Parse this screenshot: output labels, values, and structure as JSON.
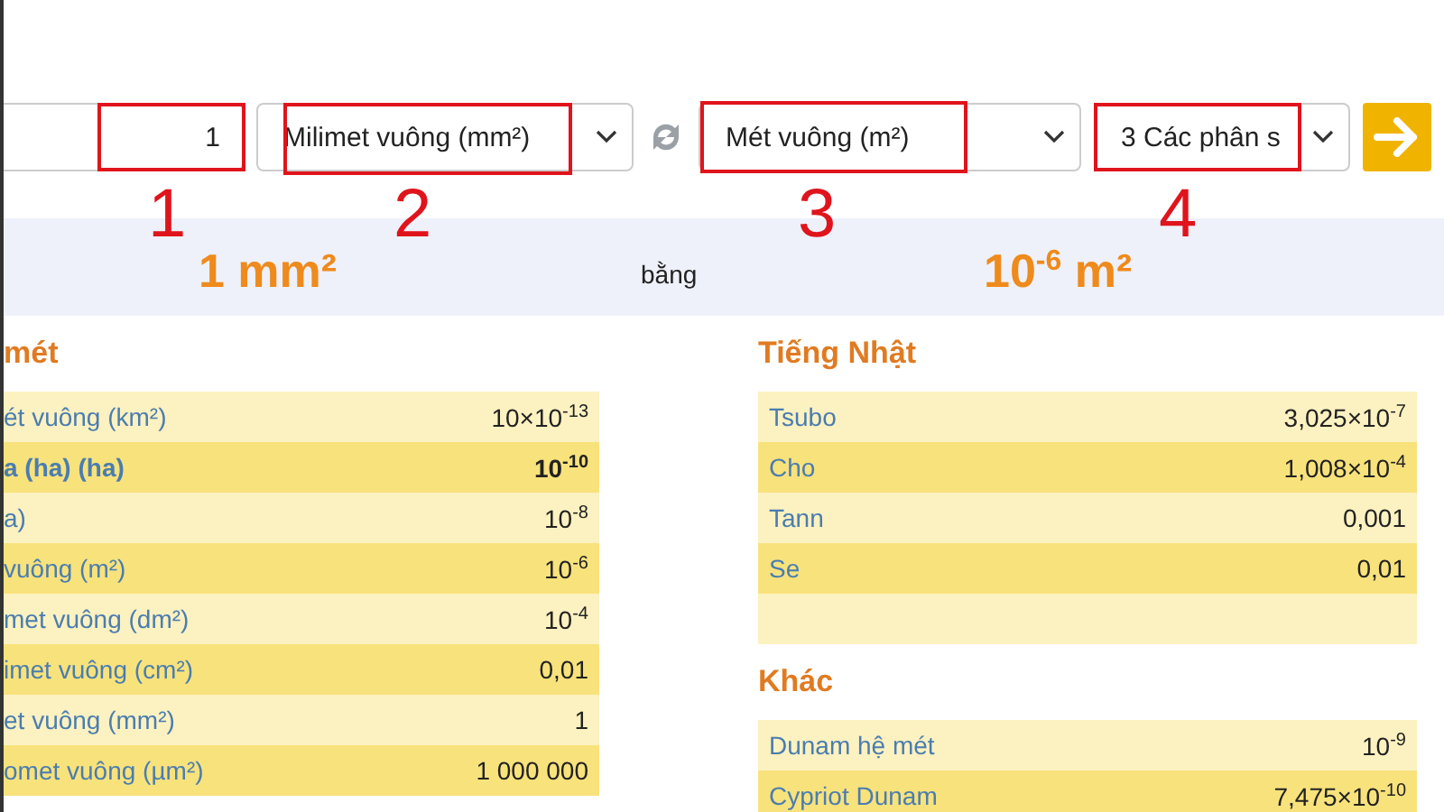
{
  "converter": {
    "amount": {
      "value": "1"
    },
    "from_unit": {
      "value": "Milimet vuông (mm²)"
    },
    "to_unit": {
      "value": "Mét vuông (m²)"
    },
    "precision": {
      "value": "3 Các phân s"
    }
  },
  "annotations": [
    {
      "number": "1"
    },
    {
      "number": "2"
    },
    {
      "number": "3"
    },
    {
      "number": "4"
    }
  ],
  "result": {
    "from": "1 mm²",
    "connector": "bằng",
    "to": "10$^{-6}$ m²"
  },
  "left_column": [
    {
      "title": "mét",
      "rows": [
        {
          "unit": "ét vuông (km²)",
          "value": "10×10$^{-13}$",
          "bold": false
        },
        {
          "unit": "a (ha) (ha)",
          "value": "10$^{-10}$",
          "bold": true
        },
        {
          "unit": "a)",
          "value": "10$^{-8}$",
          "bold": false
        },
        {
          "unit": "vuông (m²)",
          "value": "10$^{-6}$",
          "bold": false
        },
        {
          "unit": "met vuông (dm²)",
          "value": "10$^{-4}$",
          "bold": false
        },
        {
          "unit": "imet vuông (cm²)",
          "value": "0,01",
          "bold": false
        },
        {
          "unit": "et vuông (mm²)",
          "value": "1",
          "bold": false
        },
        {
          "unit": "omet vuông (µm²)",
          "value": "1 000 000",
          "bold": false
        }
      ]
    }
  ],
  "right_column": [
    {
      "title": "Tiếng Nhật",
      "rows": [
        {
          "unit": "Tsubo",
          "value": "3,025×10$^{-7}$",
          "bold": false
        },
        {
          "unit": "Cho",
          "value": "1,008×10$^{-4}$",
          "bold": false
        },
        {
          "unit": "Tann",
          "value": "0,001",
          "bold": false
        },
        {
          "unit": "Se",
          "value": "0,01",
          "bold": false
        },
        {}
      ]
    },
    {
      "title": "Khác",
      "rows": [
        {
          "unit": "Dunam hệ mét",
          "value": "10$^{-9}$",
          "bold": false
        },
        {
          "unit": "Cypriot Dunam",
          "value": "7,475×10$^{-10}$",
          "bold": false
        }
      ]
    }
  ]
}
